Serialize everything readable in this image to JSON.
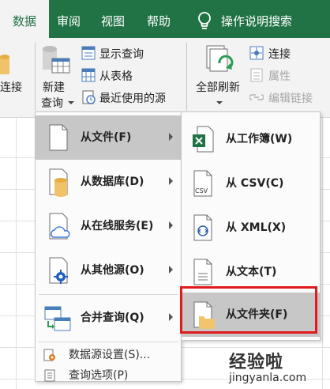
{
  "ribbon": {
    "tabs": [
      {
        "label": "数据"
      },
      {
        "label": "审阅"
      },
      {
        "label": "视图"
      },
      {
        "label": "帮助"
      }
    ],
    "tell_me": "操作说明搜索",
    "left_cut_label": "连接",
    "new_query_line1": "新建",
    "new_query_line2": "查询",
    "show_queries": "显示查询",
    "from_table": "从表格",
    "recent_sources": "最近使用的源",
    "refresh_all_line1": "全部刷新",
    "connections": "连接",
    "properties": "属性",
    "edit_links": "编辑链接"
  },
  "menu": {
    "items": [
      {
        "label": "从文件(F)",
        "has_submenu": true
      },
      {
        "label": "从数据库(D)",
        "has_submenu": true
      },
      {
        "label": "从在线服务(E)",
        "has_submenu": true
      },
      {
        "label": "从其他源(O)",
        "has_submenu": true
      },
      {
        "label": "合并查询(Q)",
        "has_submenu": true
      }
    ],
    "settings": "数据源设置(S)...",
    "query_options": "查询选项(P)"
  },
  "submenu": {
    "items": [
      {
        "label": "从工作簿(W)"
      },
      {
        "label": "从 CSV(C)"
      },
      {
        "label": "从 XML(X)"
      },
      {
        "label": "从文本(T)"
      },
      {
        "label": "从文件夹(F)"
      }
    ],
    "csv_badge": "CSV"
  },
  "watermark": {
    "top": "经验啦",
    "bottom": "jingyanla.com"
  },
  "colors": {
    "brand": "#217346",
    "highlight": "#e01b1b",
    "hover": "#c7c7c7"
  }
}
